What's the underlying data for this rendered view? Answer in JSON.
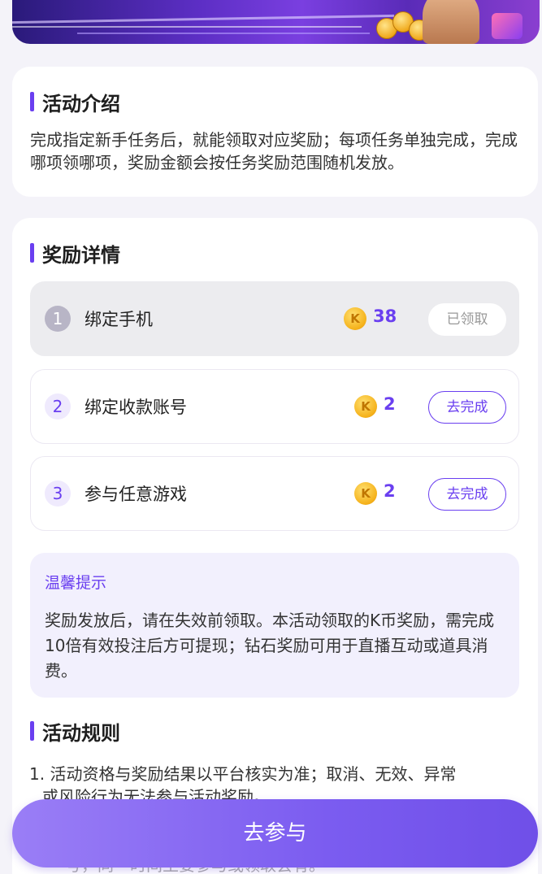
{
  "intro": {
    "title": "活动介绍",
    "text": "完成指定新手任务后，就能领取对应奖励；每项任务单独完成，完成哪项领哪项，奖励金额会按任务奖励范围随机发放。"
  },
  "rewards": {
    "title": "奖励详情",
    "coin_glyph": "K",
    "tasks": [
      {
        "num": "1",
        "name": "绑定手机",
        "amount": "38",
        "status": "已领取"
      },
      {
        "num": "2",
        "name": "绑定收款账号",
        "amount": "2",
        "status": "去完成"
      },
      {
        "num": "3",
        "name": "参与任意游戏",
        "amount": "2",
        "status": "去完成"
      }
    ],
    "tips": {
      "title": "温馨提示",
      "body": "奖励发放后，请在失效前领取。本活动领取的K币奖励，需完成10倍有效投注后方可提现；钻石奖励可用于直播互动或道具消费。"
    }
  },
  "rules": {
    "title": "活动规则",
    "item1_line1": "1. 活动资格与奖励结果以平台核实为准；取消、无效、异常",
    "item1_line2": "或风险行为无法参与活动奖励。",
    "item2_partial": "号，同一时间主要参与或领取会有。"
  },
  "cta": {
    "label": "去参与"
  },
  "colors": {
    "accent": "#6a3ff0",
    "background": "#f4f3f9"
  }
}
